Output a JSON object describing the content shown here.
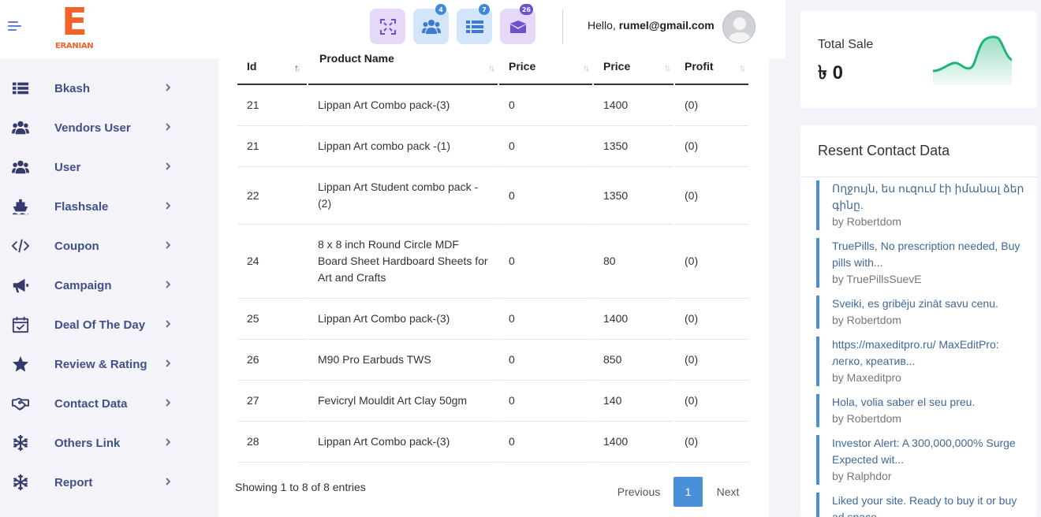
{
  "brand": {
    "letter": "E",
    "name": "ERANIAN"
  },
  "sidebar": {
    "items": [
      {
        "label": "Bkash",
        "icon": "list-icon"
      },
      {
        "label": "Vendors User",
        "icon": "users-icon"
      },
      {
        "label": "User",
        "icon": "users-icon"
      },
      {
        "label": "Flashsale",
        "icon": "ship-icon"
      },
      {
        "label": "Coupon",
        "icon": "code-icon"
      },
      {
        "label": "Campaign",
        "icon": "megaphone-icon"
      },
      {
        "label": "Deal Of The Day",
        "icon": "calendar-check-icon"
      },
      {
        "label": "Review & Rating",
        "icon": "star-icon"
      },
      {
        "label": "Contact Data",
        "icon": "handshake-icon"
      },
      {
        "label": "Others Link",
        "icon": "snowflake-icon"
      },
      {
        "label": "Report",
        "icon": "snowflake-icon"
      }
    ]
  },
  "header": {
    "badges": {
      "users": "4",
      "list": "7",
      "mail": "26"
    },
    "greeting": "Hello,",
    "user_email": "rumel@gmail.com"
  },
  "table": {
    "columns": [
      "Id",
      "Product Name",
      "Price",
      "Price",
      "Profit"
    ],
    "rows": [
      {
        "id": "21",
        "name": "Lippan Art Combo pack-(3)",
        "price1": "0",
        "price2": "1400",
        "profit": "(0)"
      },
      {
        "id": "21",
        "name": "Lippan Art combo pack -(1)",
        "price1": "0",
        "price2": "1350",
        "profit": "(0)"
      },
      {
        "id": "22",
        "name": "Lippan Art Student combo pack -(2)",
        "price1": "0",
        "price2": "1350",
        "profit": "(0)"
      },
      {
        "id": "24",
        "name": "8 x 8 inch Round Circle MDF Board Sheet Hardboard Sheets for Art and Crafts",
        "price1": "0",
        "price2": "80",
        "profit": "(0)"
      },
      {
        "id": "25",
        "name": "Lippan Art Combo pack-(3)",
        "price1": "0",
        "price2": "1400",
        "profit": "(0)"
      },
      {
        "id": "26",
        "name": "M90 Pro Earbuds TWS",
        "price1": "0",
        "price2": "850",
        "profit": "(0)"
      },
      {
        "id": "27",
        "name": "Fevicryl Mouldit Art Clay 50gm",
        "price1": "0",
        "price2": "140",
        "profit": "(0)"
      },
      {
        "id": "28",
        "name": "Lippan Art Combo pack-(3)",
        "price1": "0",
        "price2": "1400",
        "profit": "(0)"
      }
    ],
    "showing": "Showing 1 to 8 of 8 entries",
    "pagination": {
      "previous": "Previous",
      "current": "1",
      "next": "Next"
    }
  },
  "total_sale": {
    "label": "Total Sale",
    "value": "৳ 0"
  },
  "contacts": {
    "title": "Resent Contact Data",
    "items": [
      {
        "msg": "Ողջույն, ես ուզում էի իմանալ ձեր գինը.",
        "by": "by Robertdom"
      },
      {
        "msg": "TruePills, No prescription needed, Buy pills with...",
        "by": "by TruePillsSuevE"
      },
      {
        "msg": "Sveiki, es gribēju zināt savu cenu.",
        "by": "by Robertdom"
      },
      {
        "msg": "https://maxeditpro.ru/ MaxEditPro: легко, креатив...",
        "by": "by Maxeditpro"
      },
      {
        "msg": "Hola, volia saber el seu preu.",
        "by": "by Robertdom"
      },
      {
        "msg": "Investor Alert: A 300,000,000% Surge Expected wit...",
        "by": "by Ralphdor"
      },
      {
        "msg": "Liked your site. Ready to buy it or buy ad space.",
        "by": ""
      }
    ]
  },
  "colors": {
    "accent": "#4a90d9",
    "nav_text": "#405189",
    "brand": "#f0632b",
    "chart": "#1fb57a"
  }
}
